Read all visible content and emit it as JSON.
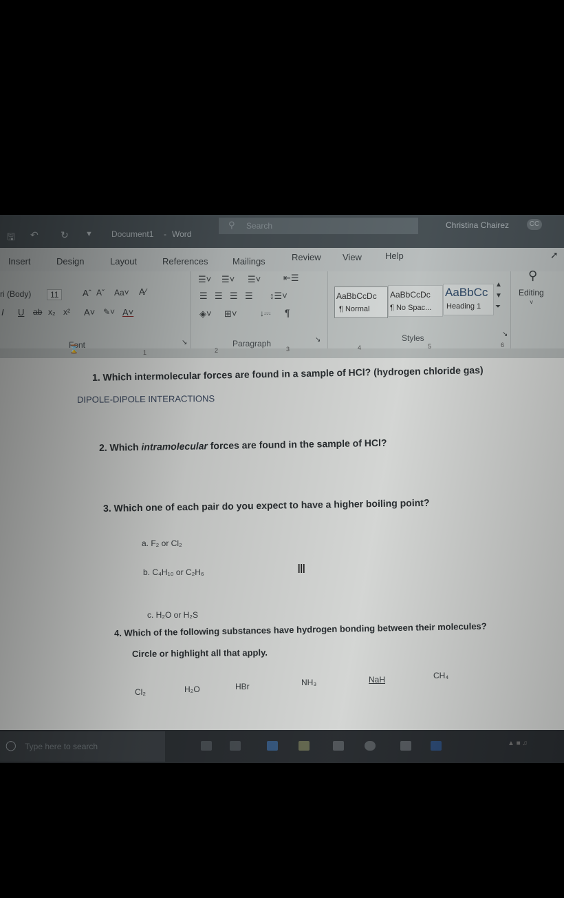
{
  "titlebar": {
    "document": "Document1",
    "separator": "-",
    "app": "Word",
    "search_placeholder": "Search",
    "user": "Christina Chairez",
    "user_initials": "CC"
  },
  "tabs": [
    "Insert",
    "Design",
    "Layout",
    "References",
    "Mailings",
    "Review",
    "View",
    "Help"
  ],
  "font": {
    "name": "ri (Body)",
    "size": "11",
    "group_label": "Font"
  },
  "paragraph": {
    "group_label": "Paragraph"
  },
  "styles": {
    "items": [
      {
        "preview": "AaBbCcDc",
        "name": "¶ Normal"
      },
      {
        "preview": "AaBbCcDc",
        "name": "¶ No Spac..."
      },
      {
        "preview": "AaBbCc",
        "name": "Heading 1"
      }
    ],
    "group_label": "Styles"
  },
  "editing": {
    "label": "Editing"
  },
  "ruler": [
    "1",
    "2",
    "3",
    "4",
    "5",
    "6"
  ],
  "document": {
    "q1": "1.  Which intermolecular forces are found in a sample of HCl? (hydrogen chloride gas)",
    "a1": "DIPOLE-DIPOLE INTERACTIONS",
    "q2_prefix": "2.  Which ",
    "q2_em": "intramolecular",
    "q2_suffix": " forces are found in the sample of HCl?",
    "q3": "3.  Which one of each pair do you expect to have a higher boiling point?",
    "q3a": "a.   F₂ or Cl₂",
    "q3b": "b.   C₄H₁₀ or C₂H₆",
    "q3c": "c.   H₂O or H₂S",
    "q4_line1": "4.  Which of the following substances have hydrogen bonding between their molecules?",
    "q4_line2": "Circle or highlight all that apply.",
    "substances": [
      "Cl₂",
      "H₂O",
      "HBr",
      "NH₃",
      "NaH",
      "CH₄"
    ]
  },
  "taskbar": {
    "search_placeholder": "Type here to search"
  }
}
